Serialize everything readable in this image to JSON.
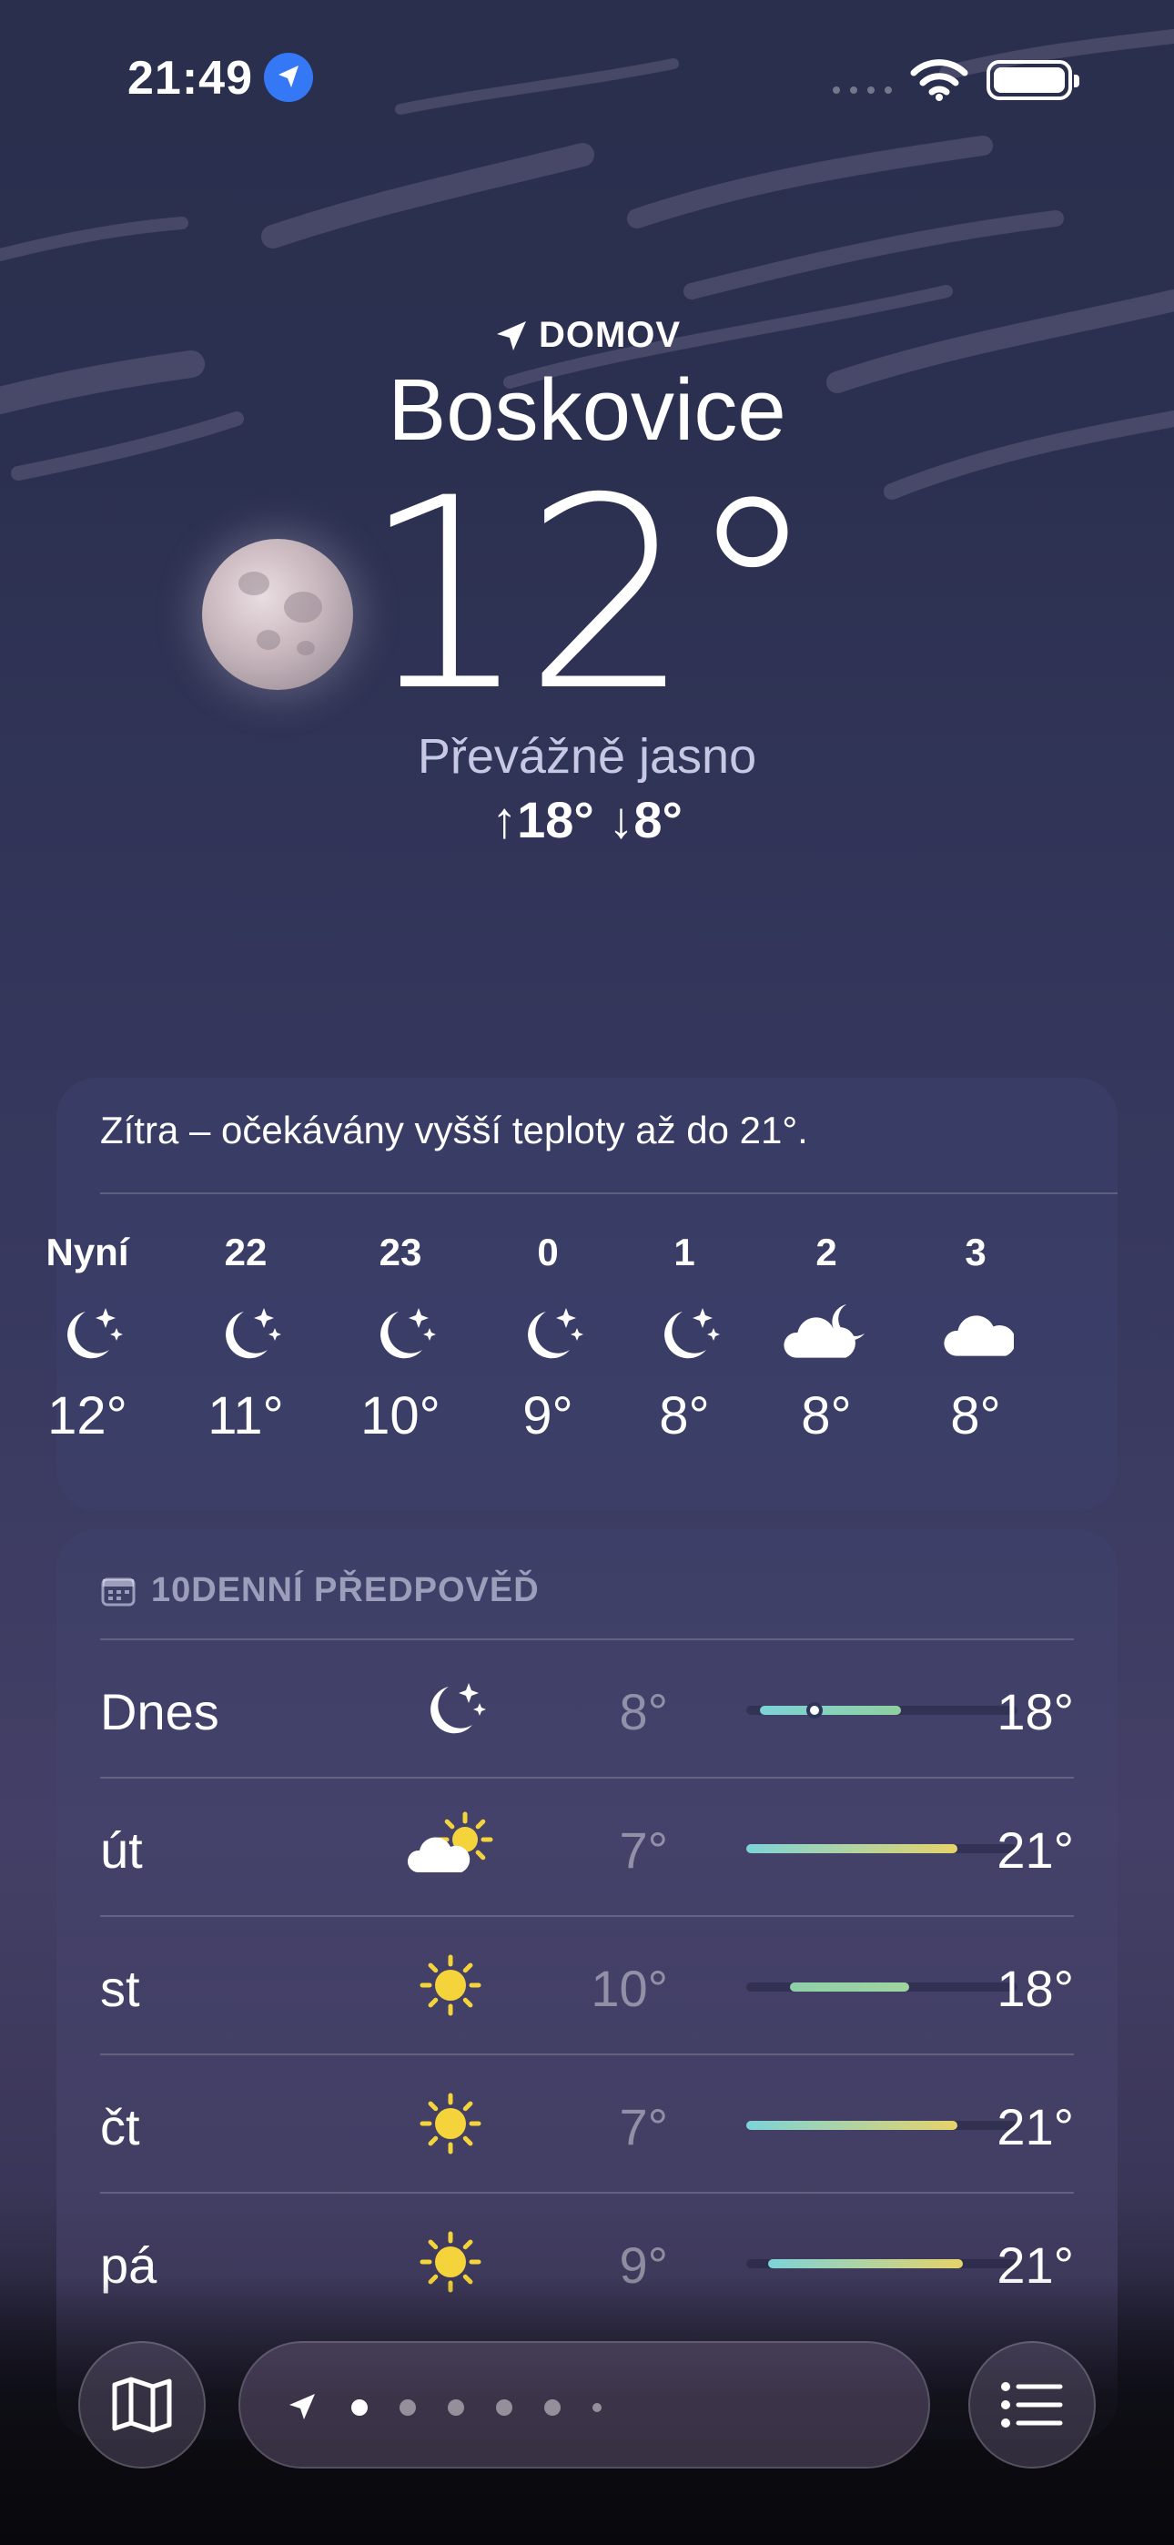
{
  "status_bar": {
    "time": "21:49"
  },
  "location": {
    "home_label": "DOMOV",
    "city": "Boskovice"
  },
  "current": {
    "temperature": "12°",
    "condition": "Převážně jasno",
    "high_low": "↑18°  ↓8°"
  },
  "hourly": {
    "note": "Zítra – očekávány vyšší teploty až do 21°.",
    "items": [
      {
        "label": "Nyní",
        "icon": "moon-stars-icon",
        "temp": "12°"
      },
      {
        "label": "22",
        "icon": "moon-stars-icon",
        "temp": "11°"
      },
      {
        "label": "23",
        "icon": "moon-stars-icon",
        "temp": "10°"
      },
      {
        "label": "0",
        "icon": "moon-stars-icon",
        "temp": "9°"
      },
      {
        "label": "1",
        "icon": "moon-stars-icon",
        "temp": "8°"
      },
      {
        "label": "2",
        "icon": "cloud-moon-icon",
        "temp": "8°"
      },
      {
        "label": "3",
        "icon": "cloud-icon",
        "temp": "8°"
      }
    ]
  },
  "daily": {
    "title": "10DENNÍ PŘEDPOVĚĎ",
    "items": [
      {
        "day": "Dnes",
        "icon": "moon-stars-icon",
        "low": "8°",
        "high": "18°",
        "bar_start": 0.05,
        "bar_end": 0.57,
        "current_marker": 0.25,
        "colors": [
          "#7dd3d8",
          "#8fd0a0"
        ]
      },
      {
        "day": "út",
        "icon": "cloud-sun-icon",
        "low": "7°",
        "high": "21°",
        "bar_start": 0.0,
        "bar_end": 0.78,
        "colors": [
          "#7dd3d8",
          "#e6d36a"
        ]
      },
      {
        "day": "st",
        "icon": "sun-icon",
        "low": "10°",
        "high": "18°",
        "bar_start": 0.16,
        "bar_end": 0.6,
        "colors": [
          "#8fd0a8",
          "#9fd4a0"
        ]
      },
      {
        "day": "čt",
        "icon": "sun-icon",
        "low": "7°",
        "high": "21°",
        "bar_start": 0.0,
        "bar_end": 0.78,
        "colors": [
          "#7dd3d8",
          "#e6d36a"
        ]
      },
      {
        "day": "pá",
        "icon": "sun-icon",
        "low": "9°",
        "high": "21°",
        "bar_start": 0.08,
        "bar_end": 0.8,
        "colors": [
          "#7dd3d8",
          "#e6d36a"
        ]
      }
    ]
  },
  "toolbar": {
    "map_icon": "map-icon",
    "list_icon": "list-icon",
    "page_count": 7,
    "active_page": 1
  },
  "colors": {
    "location_badge": "#3478f6",
    "sun": "#f5d33a"
  }
}
